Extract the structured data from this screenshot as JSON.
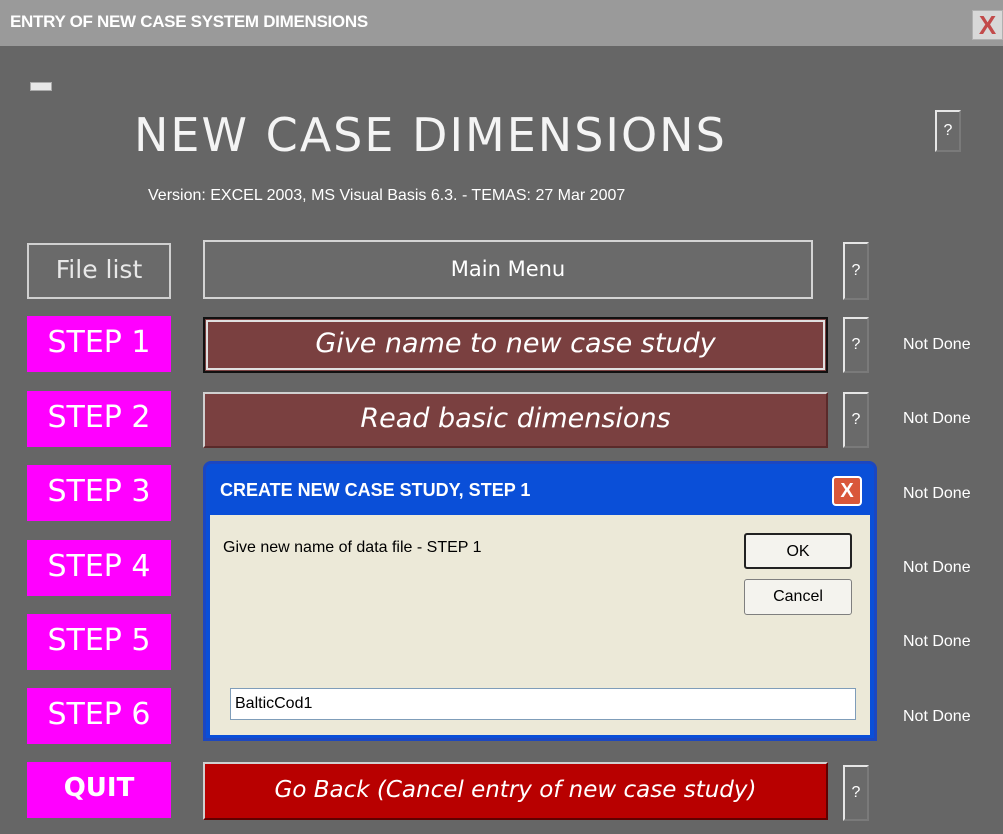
{
  "window": {
    "title": "ENTRY OF NEW CASE SYSTEM DIMENSIONS",
    "close_label": "X"
  },
  "header": {
    "title": "NEW CASE DIMENSIONS",
    "help_label": "?",
    "version": "Version: EXCEL 2003, MS Visual Basis 6.3. - TEMAS: 27 Mar 2007"
  },
  "nav": {
    "file_list": "File list",
    "main_menu": "Main Menu",
    "help_label": "?"
  },
  "steps": [
    {
      "label": "STEP 1",
      "action": "Give name to new case study",
      "status": "Not Done"
    },
    {
      "label": "STEP 2",
      "action": "Read basic dimensions",
      "status": "Not Done"
    },
    {
      "label": "STEP 3",
      "status": "Not Done"
    },
    {
      "label": "STEP 4",
      "status": "Not Done"
    },
    {
      "label": "STEP 5",
      "status": "Not Done"
    },
    {
      "label": "STEP 6",
      "status": "Not Done"
    }
  ],
  "quit": {
    "label": "QUIT",
    "action": "Go Back (Cancel entry of new case study)"
  },
  "dialog": {
    "title": "CREATE NEW CASE STUDY, STEP 1",
    "close_label": "X",
    "prompt": "Give new name of data file - STEP 1",
    "ok_label": "OK",
    "cancel_label": "Cancel",
    "input_value": "BalticCod1"
  },
  "colors": {
    "step_button": "#ff00ff",
    "action_button": "#7a4040",
    "go_back_button": "#b80000",
    "dialog_titlebar": "#0a4fd8"
  }
}
